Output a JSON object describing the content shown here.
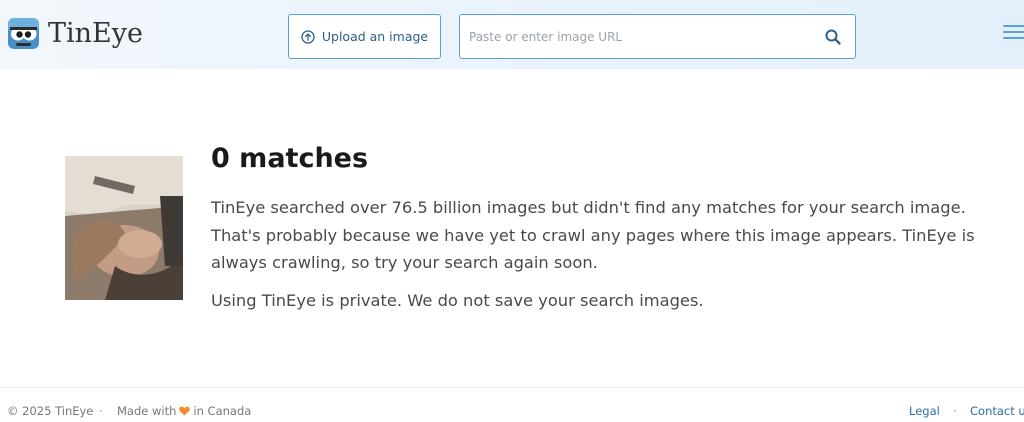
{
  "header": {
    "logo_text": "TinEye",
    "upload_label": "Upload an image",
    "url_placeholder": "Paste or enter image URL",
    "url_value": "",
    "icons": {
      "logo": "tineye-robot-icon",
      "upload": "upload-circle-icon",
      "search": "search-icon",
      "menu": "hamburger-menu-icon"
    },
    "accent_color": "#5b9fd1"
  },
  "result": {
    "title": "0 matches",
    "description": "TinEye searched over 76.5 billion images but didn't find any matches for your search image. That's probably because we have yet to crawl any pages where this image appears. TinEye is always crawling, so try your search again soon.",
    "privacy": "Using TinEye is private. We do not save your search images."
  },
  "footer": {
    "copyright": "© 2025 TinEye",
    "separator": "·",
    "made_prefix": "Made with",
    "made_suffix": "in Canada",
    "heart_icon": "heart-icon",
    "heart_color": "#f28c28",
    "legal": "Legal",
    "contact": "Contact us"
  }
}
